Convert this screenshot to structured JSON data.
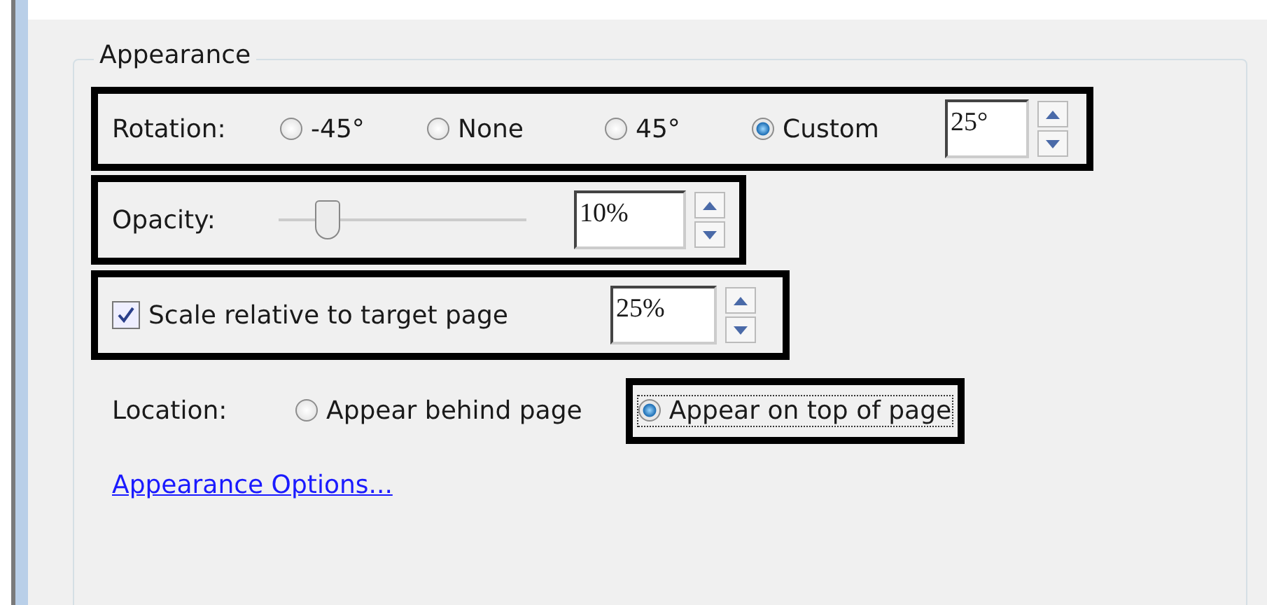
{
  "group": {
    "title": "Appearance"
  },
  "rotation": {
    "label": "Rotation:",
    "options": [
      {
        "label": "-45°",
        "selected": false
      },
      {
        "label": "None",
        "selected": false
      },
      {
        "label": "45°",
        "selected": false
      },
      {
        "label": "Custom",
        "selected": true
      }
    ],
    "value": "25°"
  },
  "opacity": {
    "label": "Opacity:",
    "level": 0.15,
    "value": "10%"
  },
  "scale": {
    "label": "Scale relative to target page",
    "checked": true,
    "value": "25%"
  },
  "location": {
    "label": "Location:",
    "options": [
      {
        "label": "Appear behind page",
        "selected": false,
        "highlighted": false
      },
      {
        "label": "Appear on top of page",
        "selected": true,
        "highlighted": true
      }
    ]
  },
  "link": "Appearance Options..."
}
